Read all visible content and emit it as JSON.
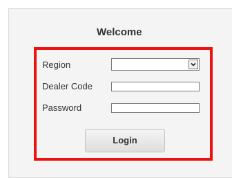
{
  "form": {
    "title": "Welcome",
    "region_label": "Region",
    "region_value": "",
    "dealer_code_label": "Dealer Code",
    "dealer_code_value": "",
    "password_label": "Password",
    "password_value": "",
    "login_label": "Login"
  },
  "icons": {
    "select_arrow": "chevron-down-icon"
  },
  "colors": {
    "highlight_border": "#ee1111",
    "panel_background": "#f4f4f4",
    "text": "#333333"
  }
}
